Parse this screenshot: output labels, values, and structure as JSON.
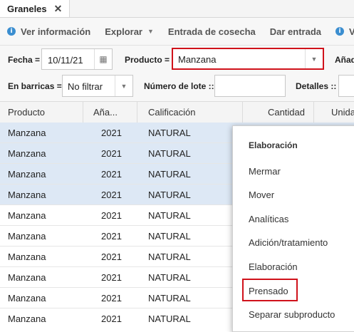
{
  "tab": {
    "label": "Graneles",
    "close": "✕"
  },
  "toolbar": {
    "ver_info": "Ver información",
    "explorar": "Explorar",
    "entrada_cosecha": "Entrada de cosecha",
    "dar_entrada": "Dar entrada",
    "ver_partial": "Ve"
  },
  "filters": {
    "fecha_label": "Fecha =",
    "fecha_value": "10/11/21",
    "producto_label": "Producto =",
    "producto_value": "Manzana",
    "anada_label": "Añad",
    "barricas_label": "En barricas =",
    "barricas_value": "No filtrar",
    "lote_label": "Número de lote ::",
    "lote_value": "",
    "detalles_label": "Detalles ::"
  },
  "grid": {
    "columns": [
      "Producto",
      "Aña...",
      "Calificación",
      "Cantidad",
      "Unida"
    ],
    "rows": [
      {
        "producto": "Manzana",
        "anada": "2021",
        "calificacion": "NATURAL",
        "selected": true
      },
      {
        "producto": "Manzana",
        "anada": "2021",
        "calificacion": "NATURAL",
        "selected": true
      },
      {
        "producto": "Manzana",
        "anada": "2021",
        "calificacion": "NATURAL",
        "selected": true
      },
      {
        "producto": "Manzana",
        "anada": "2021",
        "calificacion": "NATURAL",
        "selected": true
      },
      {
        "producto": "Manzana",
        "anada": "2021",
        "calificacion": "NATURAL",
        "selected": false
      },
      {
        "producto": "Manzana",
        "anada": "2021",
        "calificacion": "NATURAL",
        "selected": false
      },
      {
        "producto": "Manzana",
        "anada": "2021",
        "calificacion": "NATURAL",
        "selected": false
      },
      {
        "producto": "Manzana",
        "anada": "2021",
        "calificacion": "NATURAL",
        "selected": false
      },
      {
        "producto": "Manzana",
        "anada": "2021",
        "calificacion": "NATURAL",
        "selected": false
      },
      {
        "producto": "Manzana",
        "anada": "2021",
        "calificacion": "NATURAL",
        "selected": false
      }
    ]
  },
  "context_menu": {
    "title": "Elaboración",
    "items": [
      "Mermar",
      "Mover",
      "Analíticas",
      "Adición/tratamiento",
      "Elaboración",
      "Prensado",
      "Separar subproducto"
    ],
    "highlighted": "Prensado"
  },
  "colors": {
    "selection": "#dde8f5",
    "highlight_border": "#d0121b",
    "info_icon": "#3b8ed0"
  }
}
